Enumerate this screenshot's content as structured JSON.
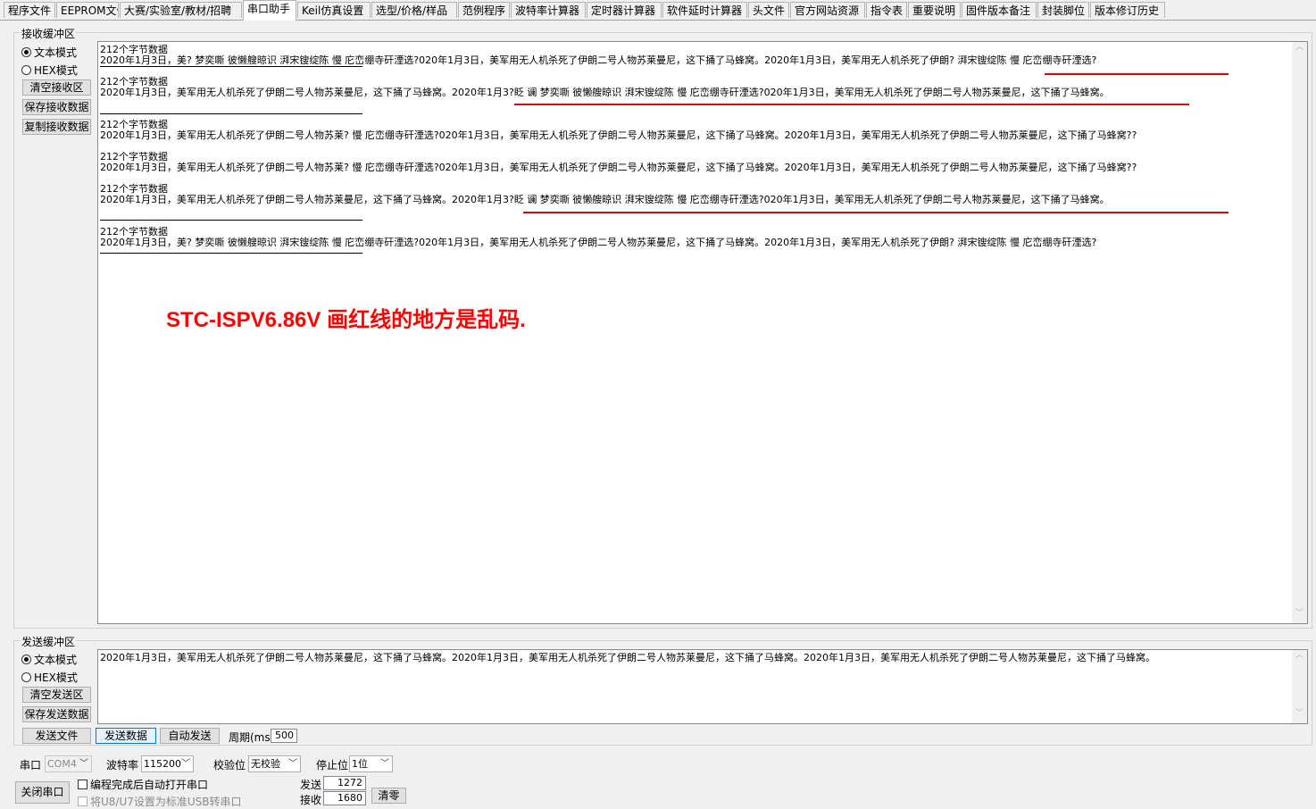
{
  "tabs": [
    "程序文件",
    "EEPROM文件",
    "大赛/实验室/教材/招聘",
    "串口助手",
    "Keil仿真设置",
    "选型/价格/样品",
    "范例程序",
    "波特率计算器",
    "定时器计算器",
    "软件延时计算器",
    "头文件",
    "官方网站资源",
    "指令表",
    "重要说明",
    "固件版本备注",
    "封装脚位",
    "版本修订历史"
  ],
  "receive": {
    "title": "接收缓冲区",
    "text_mode": "文本模式",
    "hex_mode": "HEX模式",
    "clear_btn": "清空接收区",
    "save_btn": "保存接收数据",
    "copy_btn": "复制接收数据",
    "entries": [
      {
        "header": "212个字节数据",
        "body": "2020年1月3日，美?  梦奕嘶  彼懒艘晾识  湃宋锼绽陈  慢  庀峦绷寺矸湮选?020年1月3日，美军用无人机杀死了伊朗二号人物苏莱曼尼，这下捅了马蜂窝。2020年1月3日，美军用无人机杀死了伊朗?  湃宋锼绽陈  慢  庀峦绷寺矸湮选?"
      },
      {
        "header": "212个字节数据",
        "body": "2020年1月3日，美军用无人机杀死了伊朗二号人物苏莱曼尼，这下捅了马蜂窝。2020年1月3?眨  谰  梦奕嘶  彼懒艘晾识  湃宋锼绽陈  慢  庀峦绷寺矸湮选?020年1月3日，美军用无人机杀死了伊朗二号人物苏莱曼尼，这下捅了马蜂窝。"
      },
      {
        "header": "212个字节数据",
        "body": "2020年1月3日，美军用无人机杀死了伊朗二号人物苏莱?  慢  庀峦绷寺矸湮选?020年1月3日，美军用无人机杀死了伊朗二号人物苏莱曼尼，这下捅了马蜂窝。2020年1月3日，美军用无人机杀死了伊朗二号人物苏莱曼尼，这下捅了马蜂窝??"
      },
      {
        "header": "212个字节数据",
        "body": "2020年1月3日，美军用无人机杀死了伊朗二号人物苏莱?  慢  庀峦绷寺矸湮选?020年1月3日，美军用无人机杀死了伊朗二号人物苏莱曼尼，这下捅了马蜂窝。2020年1月3日，美军用无人机杀死了伊朗二号人物苏莱曼尼，这下捅了马蜂窝??"
      },
      {
        "header": "212个字节数据",
        "body": "2020年1月3日，美军用无人机杀死了伊朗二号人物苏莱曼尼，这下捅了马蜂窝。2020年1月3?眨  谰  梦奕嘶  彼懒艘晾识  湃宋锼绽陈  慢  庀峦绷寺矸湮选?020年1月3日，美军用无人机杀死了伊朗二号人物苏莱曼尼，这下捅了马蜂窝。"
      },
      {
        "header": "212个字节数据",
        "body": "2020年1月3日，美?  梦奕嘶  彼懒艘晾识  湃宋锼绽陈  慢  庀峦绷寺矸湮选?020年1月3日，美军用无人机杀死了伊朗二号人物苏莱曼尼，这下捅了马蜂窝。2020年1月3日，美军用无人机杀死了伊朗?  湃宋锼绽陈  慢  庀峦绷寺矸湮选?"
      }
    ],
    "annotation": "STC-ISPV6.86V 画红线的地方是乱码."
  },
  "send": {
    "title": "发送缓冲区",
    "text_mode": "文本模式",
    "hex_mode": "HEX模式",
    "clear_btn": "清空发送区",
    "save_btn": "保存发送数据",
    "content": "2020年1月3日，美军用无人机杀死了伊朗二号人物苏莱曼尼，这下捅了马蜂窝。2020年1月3日，美军用无人机杀死了伊朗二号人物苏莱曼尼，这下捅了马蜂窝。2020年1月3日，美军用无人机杀死了伊朗二号人物苏莱曼尼，这下捅了马蜂窝。",
    "send_file_btn": "发送文件",
    "send_data_btn": "发送数据",
    "auto_send_btn": "自动发送",
    "period_label": "周期(ms)",
    "period_value": "500"
  },
  "settings": {
    "port_label": "串口",
    "port_value": "COM4",
    "baud_label": "波特率",
    "baud_value": "115200",
    "parity_label": "校验位",
    "parity_value": "无校验",
    "stop_label": "停止位",
    "stop_value": "1位",
    "close_btn": "关闭串口",
    "auto_open": "编程完成后自动打开串口",
    "usb_option": "将U8/U7设置为标准USB转串口",
    "sent_label": "发送",
    "sent_value": "1272",
    "recv_label": "接收",
    "recv_value": "1680",
    "clear_btn": "清零"
  }
}
